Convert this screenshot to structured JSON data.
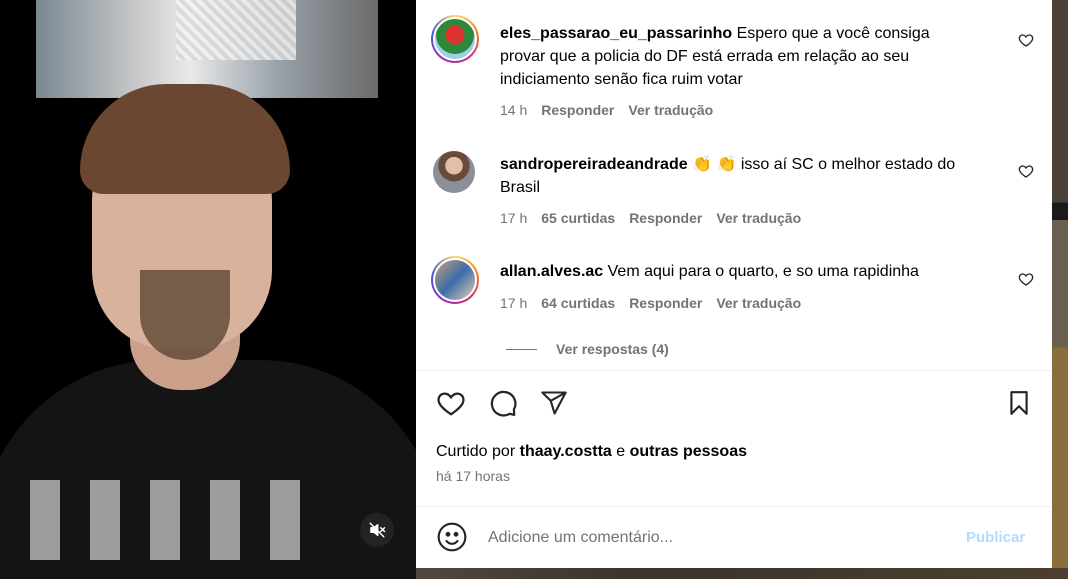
{
  "comments": [
    {
      "username": "eles_passarao_eu_passarinho",
      "text": "Espero que a você consiga provar que a policia do DF está errada em relação ao seu indiciamento senão fica ruim votar",
      "time": "14 h",
      "likes": "",
      "reply": "Responder",
      "translate": "Ver tradução"
    },
    {
      "username": "sandropereiradeandrade",
      "text": "👏 👏 isso aí SC o melhor estado do Brasil",
      "time": "17 h",
      "likes": "65 curtidas",
      "reply": "Responder",
      "translate": "Ver tradução"
    },
    {
      "username": "allan.alves.ac",
      "text": "Vem aqui para o quarto, e so uma rapidinha",
      "time": "17 h",
      "likes": "64 curtidas",
      "reply": "Responder",
      "translate": "Ver tradução"
    }
  ],
  "view_replies": "Ver respostas (4)",
  "liked_by": {
    "prefix": "Curtido por",
    "user": "thaay.costta",
    "connector": "e",
    "others": "outras pessoas"
  },
  "post_time": "há 17 horas",
  "compose": {
    "placeholder": "Adicione um comentário...",
    "publish": "Publicar"
  },
  "colors": {
    "secondary_text": "#737373",
    "publish_disabled": "#b3dbff",
    "divider": "#efefef"
  },
  "icons": [
    "heart-icon",
    "comment-icon",
    "share-icon",
    "bookmark-icon",
    "emoji-icon",
    "muted-speaker-icon"
  ]
}
